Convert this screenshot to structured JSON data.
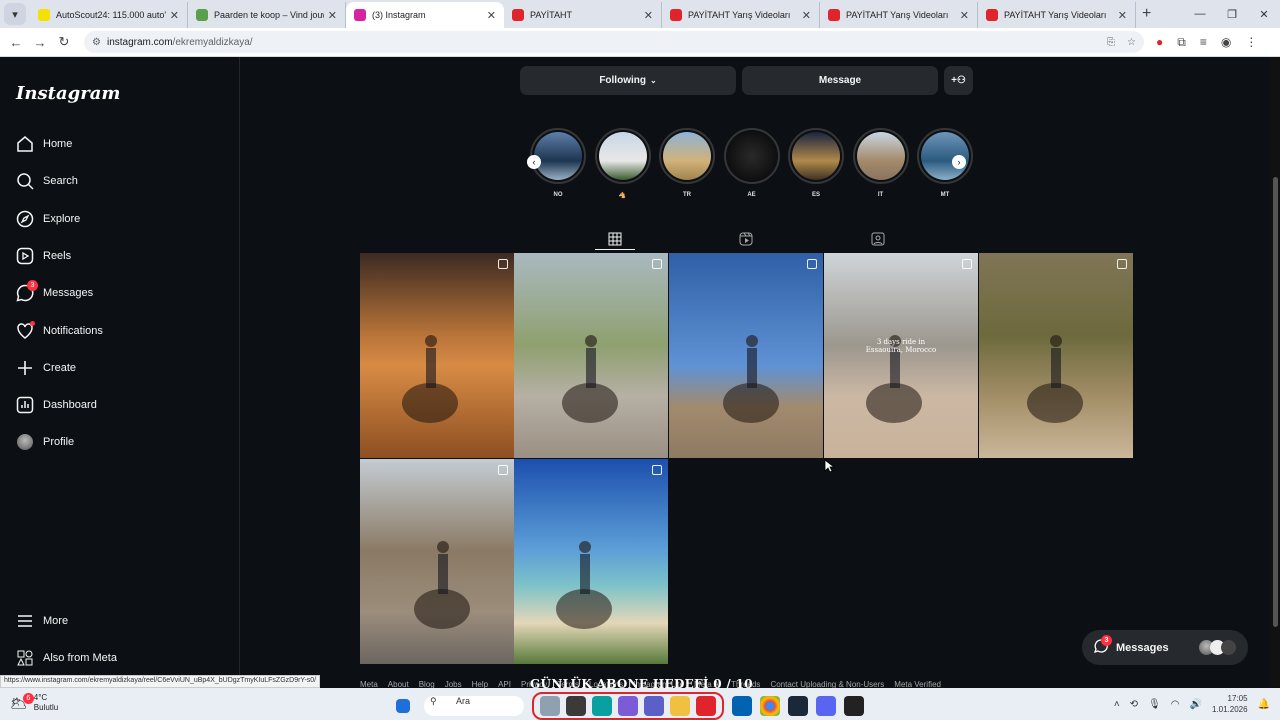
{
  "tabs": [
    {
      "title": "AutoScout24: 115.000 auto's o...",
      "color": "#f5e100"
    },
    {
      "title": "Paarden te koop – Vind jouw id...",
      "color": "#5aa04b"
    },
    {
      "title": "(3) Instagram",
      "color": "#d6249f"
    },
    {
      "title": "PAYİTAHT",
      "color": "#e0242b"
    },
    {
      "title": "PAYİTAHT Yarış Videoları",
      "color": "#e0242b"
    },
    {
      "title": "PAYİTAHT Yarış Videoları",
      "color": "#e0242b"
    },
    {
      "title": "PAYİTAHT Yarış Videoları",
      "color": "#e0242b"
    }
  ],
  "address": {
    "domain": "instagram.com",
    "path": "/ekremyaldizkaya/"
  },
  "sidebar": {
    "logo": "Instagram",
    "items": [
      {
        "label": "Home",
        "icon": "home-icon"
      },
      {
        "label": "Search",
        "icon": "search-icon"
      },
      {
        "label": "Explore",
        "icon": "compass-icon"
      },
      {
        "label": "Reels",
        "icon": "reels-icon"
      },
      {
        "label": "Messages",
        "icon": "messenger-icon",
        "badge": "3"
      },
      {
        "label": "Notifications",
        "icon": "heart-icon"
      },
      {
        "label": "Create",
        "icon": "plus-icon"
      },
      {
        "label": "Dashboard",
        "icon": "dashboard-icon"
      },
      {
        "label": "Profile",
        "icon": "avatar"
      }
    ],
    "more": "More",
    "meta": "Also from Meta"
  },
  "profile": {
    "following_label": "Following",
    "message_label": "Message"
  },
  "highlights": [
    {
      "label": "NO",
      "bg": "linear-gradient(#5d7fa8,#1e3551 60%,#9ab1c4)"
    },
    {
      "label": "🐴",
      "bg": "linear-gradient(#c8d6e6,#e8e8e8 60%,#3a5a2c)"
    },
    {
      "label": "TR",
      "bg": "linear-gradient(#8fb2d6,#d1b27a 60%,#a1834f)"
    },
    {
      "label": "AE",
      "bg": "radial-gradient(#2a2a2a,#050505)"
    },
    {
      "label": "ES",
      "bg": "linear-gradient(#1a2440,#b08a4a 60%,#3d3124)"
    },
    {
      "label": "IT",
      "bg": "linear-gradient(#c7d6e2,#a48a6a 60%,#8a7460)"
    },
    {
      "label": "MT",
      "bg": "linear-gradient(#6d95b8,#2b5a80 60%,#8cb0c7)"
    }
  ],
  "posts": [
    {
      "bg": "linear-gradient(#3b2a22,#b9743a 40%,#d78b45 55%,#8e4f22)",
      "caption": ""
    },
    {
      "bg": "linear-gradient(#a9b9c0,#8fa070 45%,#b6b0a5 70%,#9a8f82)",
      "caption": ""
    },
    {
      "bg": "linear-gradient(#2f5fa6,#5f92d4 55%,#a28a6d 75%,#8e7a62)",
      "caption": ""
    },
    {
      "bg": "linear-gradient(#cfd5d8,#9c978e 45%,#cbb8a4 70%,#c9b29a)",
      "caption": "3 days ride in\nEssaouira, Morocco"
    },
    {
      "bg": "linear-gradient(#807556,#6d6a3d 40%,#a28e66 70%,#cbb79a)",
      "caption": ""
    },
    {
      "bg": "linear-gradient(#c4ccd3,#8a7a64 45%,#9c8d7c 75%,#6c6660)",
      "caption": ""
    },
    {
      "bg": "linear-gradient(#1c4fae,#5ea0d8 45%,#7ec3c8 62%,#e4d7b8 80%,#58793b)",
      "caption": ""
    }
  ],
  "footer": [
    "Meta",
    "About",
    "Blog",
    "Jobs",
    "Help",
    "API",
    "Privacy",
    "Terms",
    "Locations",
    "Instagram Lite",
    "Meta AI",
    "Threads",
    "Contact Uploading & Non-Users",
    "Meta Verified"
  ],
  "overlay_text": "GÜNLÜK ABONE HEDEFİ 0 / 10",
  "status_url": "https://www.instagram.com/ekremyaldizkaya/reel/C6eVviUN_uBp4X_bUDgzTmyKIuLFsZGzD9rY-s0/",
  "messages_pill": {
    "label": "Messages",
    "badge": "3"
  },
  "taskbar": {
    "weather_temp": "4°C",
    "weather_text": "Bulutlu",
    "weather_badge": "6",
    "search_placeholder": "Ara",
    "time": "17:05",
    "date": "1.01.2026"
  }
}
